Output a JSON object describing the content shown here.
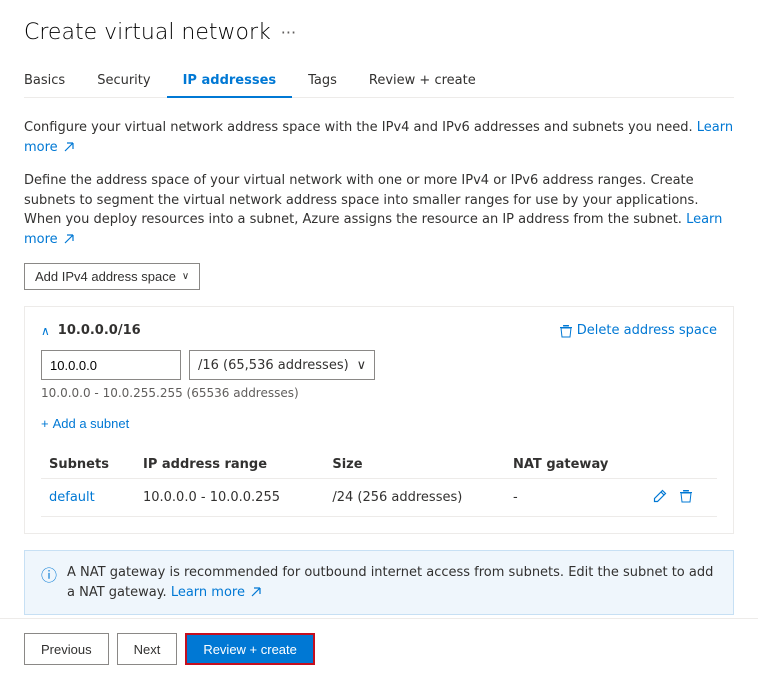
{
  "page": {
    "title": "Create virtual network",
    "ellipsis": "···"
  },
  "tabs": [
    {
      "id": "basics",
      "label": "Basics",
      "active": false
    },
    {
      "id": "security",
      "label": "Security",
      "active": false
    },
    {
      "id": "ip-addresses",
      "label": "IP addresses",
      "active": true
    },
    {
      "id": "tags",
      "label": "Tags",
      "active": false
    },
    {
      "id": "review-create",
      "label": "Review + create",
      "active": false
    }
  ],
  "description1": "Configure your virtual network address space with the IPv4 and IPv6 addresses and subnets you need.",
  "description1_link": "Learn more",
  "description2_part1": "Define the address space of your virtual network with one or more IPv4 or IPv6 address ranges. Create subnets to segment the virtual network address space into smaller ranges for use by your applications. When you deploy resources into a subnet, Azure assigns the resource an IP address from the subnet.",
  "description2_link": "Learn more",
  "add_ipv4_btn": "Add IPv4 address space",
  "address_space": {
    "cidr": "10.0.0.0/16",
    "ip_value": "10.0.0.0",
    "cidr_label": "/16 (65,536 addresses)",
    "range_hint": "10.0.0.0 - 10.0.255.255 (65536 addresses)",
    "delete_label": "Delete address space",
    "add_subnet_label": "Add a subnet"
  },
  "table": {
    "headers": [
      "Subnets",
      "IP address range",
      "Size",
      "NAT gateway"
    ],
    "rows": [
      {
        "subnet": "default",
        "ip_range": "10.0.0.0 - 10.0.0.255",
        "size": "/24 (256 addresses)",
        "nat": "-"
      }
    ]
  },
  "info_banner": {
    "text": "A NAT gateway is recommended for outbound internet access from subnets. Edit the subnet to add a NAT gateway.",
    "link": "Learn more"
  },
  "footer": {
    "previous": "Previous",
    "next": "Next",
    "review_create": "Review + create"
  },
  "icons": {
    "ellipsis": "···",
    "chevron_down": "∨",
    "plus": "+",
    "collapse": "∧",
    "info": "ⓘ",
    "edit": "✏",
    "delete": "🗑",
    "external_link": "↗"
  }
}
